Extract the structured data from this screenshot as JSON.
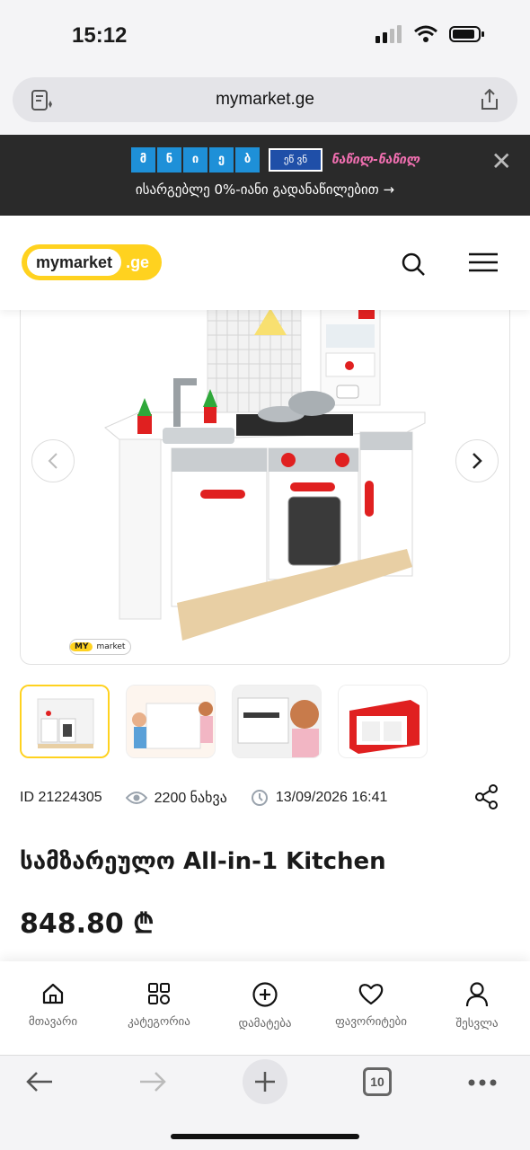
{
  "status": {
    "time": "15:12"
  },
  "browser": {
    "url": "mymarket.ge",
    "tab_count": "10"
  },
  "promo": {
    "brand_letters": [
      "მ",
      "ნ",
      "ი",
      "ე",
      "ბ"
    ],
    "badge": "ეწ ვნ",
    "pink_logo": "ნაწილ-ნაწილ",
    "text": "ისარგებლე 0%-იანი გადანაწილებით →"
  },
  "header": {
    "logo_main": "mymarket",
    "logo_ge": ".ge"
  },
  "gallery": {
    "badge_my": "MY",
    "badge_market": "market"
  },
  "meta": {
    "id": "ID 21224305",
    "views": "2200 ნახვა",
    "date": "13/09/2026 16:41"
  },
  "product": {
    "title": "სამზარეულო All-in-1 Kitchen",
    "price": "848.80 ₾"
  },
  "bottom_nav": [
    {
      "label": "მთავარი",
      "icon": "home-icon"
    },
    {
      "label": "კატეგორია",
      "icon": "grid-icon"
    },
    {
      "label": "დამატება",
      "icon": "plus-circle-icon"
    },
    {
      "label": "ფავორიტები",
      "icon": "heart-icon"
    },
    {
      "label": "შესვლა",
      "icon": "user-icon"
    }
  ],
  "colors": {
    "brand_yellow": "#ffd21f",
    "promo_bg": "#2a2a2a",
    "accent_red": "#e02020"
  }
}
